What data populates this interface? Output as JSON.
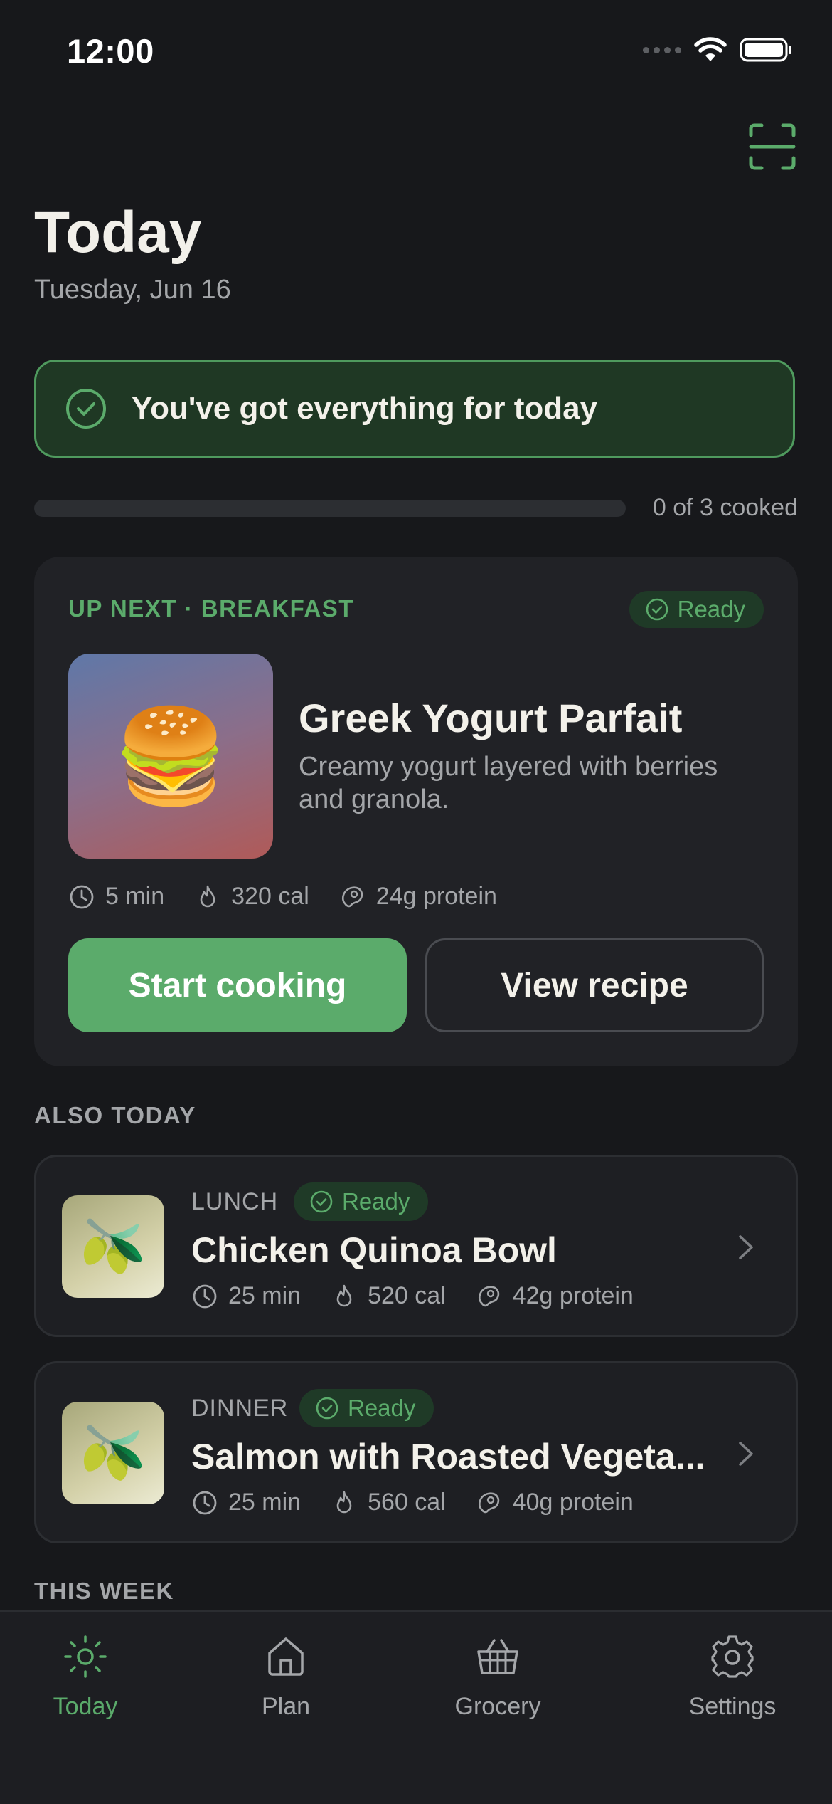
{
  "status_bar": {
    "time": "12:00"
  },
  "header": {
    "title": "Today",
    "date": "Tuesday, Jun 16"
  },
  "banner": {
    "text": "You've got everything for today"
  },
  "progress": {
    "label": "0 of 3 cooked",
    "fraction": 0.0
  },
  "up_next": {
    "eyebrow": "UP NEXT · BREAKFAST",
    "status": "Ready",
    "image_emoji": "🍔",
    "title": "Greek Yogurt Parfait",
    "description": "Creamy yogurt layered with berries and granola.",
    "time": "5 min",
    "calories": "320 cal",
    "protein": "24g protein",
    "primary_action": "Start cooking",
    "secondary_action": "View recipe"
  },
  "also_today": {
    "label": "ALSO TODAY",
    "meals": [
      {
        "kind": "LUNCH",
        "status": "Ready",
        "emoji": "🫒",
        "name": "Chicken Quinoa Bowl",
        "time": "25 min",
        "calories": "520 cal",
        "protein": "42g protein"
      },
      {
        "kind": "DINNER",
        "status": "Ready",
        "emoji": "🫒",
        "name": "Salmon with Roasted Vegeta...",
        "time": "25 min",
        "calories": "560 cal",
        "protein": "40g protein"
      }
    ]
  },
  "this_week": {
    "label": "THIS WEEK"
  },
  "tabs": [
    {
      "label": "Today",
      "icon": "sun-icon",
      "active": true
    },
    {
      "label": "Plan",
      "icon": "home-icon",
      "active": false
    },
    {
      "label": "Grocery",
      "icon": "basket-icon",
      "active": false
    },
    {
      "label": "Settings",
      "icon": "gear-icon",
      "active": false
    }
  ],
  "colors": {
    "accent": "#5bab6b",
    "background": "#17181b",
    "card": "#212226",
    "muted": "#a4a6a9"
  }
}
